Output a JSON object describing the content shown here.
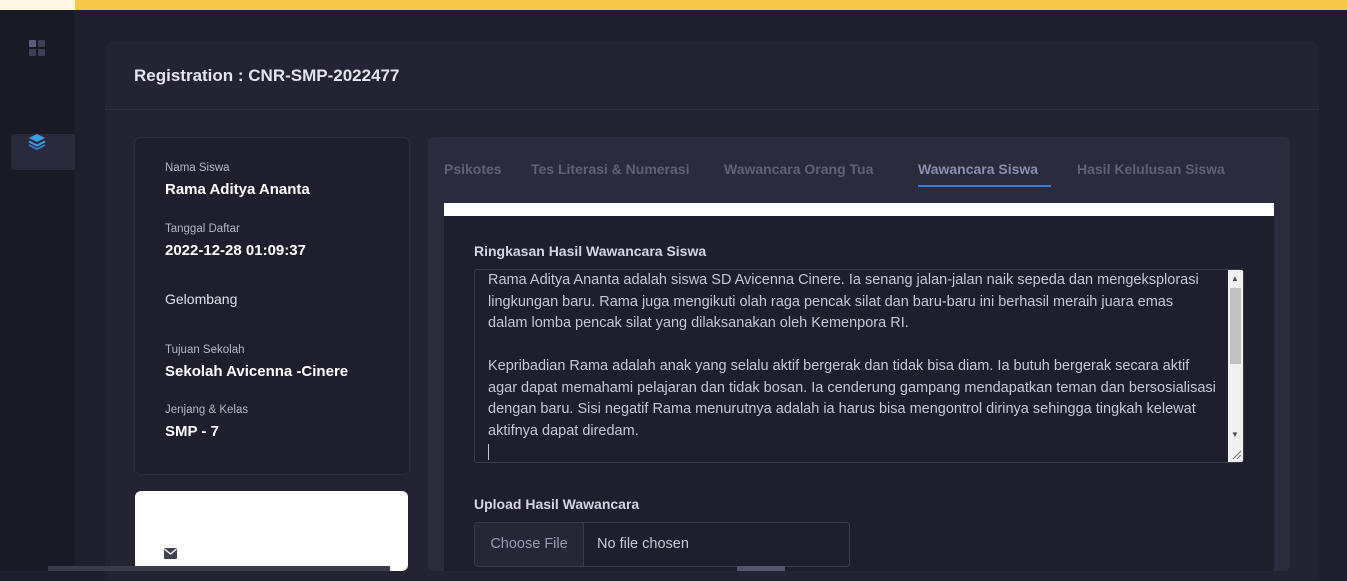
{
  "header": {
    "title": "Registration : CNR-SMP-2022477"
  },
  "sidebar": {
    "icons": [
      "grid-icon",
      "layers-icon"
    ]
  },
  "student_info": {
    "name_label": "Nama Siswa",
    "name_value": "Rama Aditya Ananta",
    "date_label": "Tanggal Daftar",
    "date_value": "2022-12-28 01:09:37",
    "wave_label": "Gelombang",
    "school_label": "Tujuan Sekolah",
    "school_value": "Sekolah Avicenna -Cinere",
    "grade_label": "Jenjang & Kelas",
    "grade_value": "SMP - 7"
  },
  "tabs": [
    {
      "label": "Psikotes"
    },
    {
      "label": "Tes Literasi & Numerasi"
    },
    {
      "label": "Wawancara Orang Tua"
    },
    {
      "label": "Wawancara Siswa"
    },
    {
      "label": "Hasil Kelulusan Siswa"
    }
  ],
  "active_tab": "Wawancara Siswa",
  "summary": {
    "label": "Ringkasan Hasil Wawancara Siswa",
    "text": "Rama Aditya Ananta adalah siswa SD Avicenna Cinere. Ia senang jalan-jalan naik sepeda dan mengeksplorasi lingkungan baru. Rama juga mengikuti olah raga pencak silat dan baru-baru ini berhasil meraih juara emas dalam lomba pencak silat yang dilaksanakan oleh Kemenpora RI.\n\nKepribadian Rama adalah anak yang selalu aktif bergerak dan tidak bisa diam. Ia butuh bergerak secara aktif agar dapat memahami pelajaran dan tidak bosan. Ia cenderung gampang mendapatkan teman dan bersosialisasi dengan baru. Sisi negatif Rama menurutnya adalah ia harus bisa mengontrol dirinya sehingga tingkah kelewat aktifnya dapat diredam."
  },
  "upload": {
    "label": "Upload Hasil Wawancara",
    "button_label": "Choose File",
    "status": "No file chosen"
  },
  "colors": {
    "accent": "#f6c84a",
    "tab_underline": "#3b7ddd",
    "background": "#1e1e2d"
  }
}
